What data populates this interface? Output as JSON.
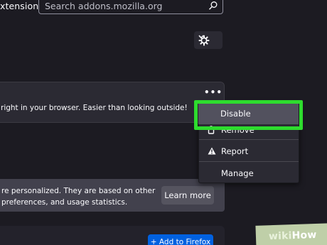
{
  "header": {
    "nav_label": "xtensions",
    "search_placeholder": "Search addons.mozilla.org"
  },
  "card": {
    "description": "right in your browser. Easier than looking outside!",
    "more_label": "•••"
  },
  "menu": {
    "items": [
      {
        "label": "Disable",
        "icon": "none"
      },
      {
        "label": "Remove",
        "icon": "trash-icon"
      },
      {
        "label": "Report",
        "icon": "warning-icon"
      },
      {
        "label": "Manage",
        "icon": "none"
      }
    ],
    "highlight_color": "#2edc2e"
  },
  "notice": {
    "line1": "re personalized. They are based on other",
    "line2": "preferences, and usage statistics.",
    "button_label": "Learn more"
  },
  "add_button_label": "+ Add to Firefox",
  "watermark": {
    "wiki": "wiki",
    "how": "How"
  },
  "colors": {
    "background": "#1c1b22",
    "card": "#2b2a33",
    "accent_blue": "#0061e0"
  }
}
